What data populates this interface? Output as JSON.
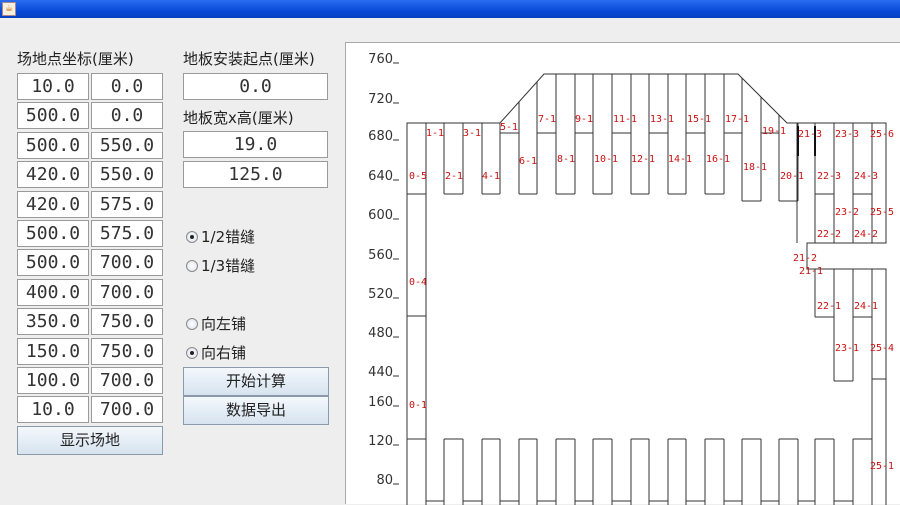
{
  "window": {
    "icon": "java-cup-icon"
  },
  "coords": {
    "label": "场地点坐标(厘米)",
    "rows": [
      [
        "10.0",
        "0.0"
      ],
      [
        "500.0",
        "0.0"
      ],
      [
        "500.0",
        "550.0"
      ],
      [
        "420.0",
        "550.0"
      ],
      [
        "420.0",
        "575.0"
      ],
      [
        "500.0",
        "575.0"
      ],
      [
        "500.0",
        "700.0"
      ],
      [
        "400.0",
        "700.0"
      ],
      [
        "350.0",
        "750.0"
      ],
      [
        "150.0",
        "750.0"
      ],
      [
        "100.0",
        "700.0"
      ],
      [
        "10.0",
        "700.0"
      ]
    ],
    "show_button": "显示场地"
  },
  "start": {
    "label": "地板安装起点(厘米)",
    "value": "0.0"
  },
  "size": {
    "label": "地板宽x高(厘米)",
    "width": "19.0",
    "height": "125.0"
  },
  "stagger": {
    "options": [
      "1/2错缝",
      "1/3错缝"
    ],
    "selected": 0
  },
  "direction": {
    "options": [
      "向左铺",
      "向右铺"
    ],
    "selected": 1
  },
  "actions": {
    "calculate": "开始计算",
    "export": "数据导出"
  },
  "chart_data": {
    "type": "diagram",
    "y_ticks": [
      "760",
      "720",
      "680",
      "640",
      "600",
      "560",
      "520",
      "480",
      "440",
      "160",
      "120",
      "80"
    ],
    "labels": [
      "0-5",
      "1-1",
      "2-1",
      "3-1",
      "4-1",
      "5-1",
      "6-1",
      "7-1",
      "8-1",
      "9-1",
      "10-1",
      "11-1",
      "12-1",
      "13-1",
      "14-1",
      "15-1",
      "16-1",
      "17-1",
      "18-1",
      "19-1",
      "20-1",
      "21-3",
      "22-3",
      "23-3",
      "24-3",
      "25-6",
      "23-2",
      "25-5",
      "22-2",
      "24-2",
      "21-2",
      "21-1",
      "22-1",
      "24-1",
      "23-1",
      "25-4",
      "0-4",
      "0-1",
      "25-1"
    ],
    "label_color": "#cc1111"
  }
}
